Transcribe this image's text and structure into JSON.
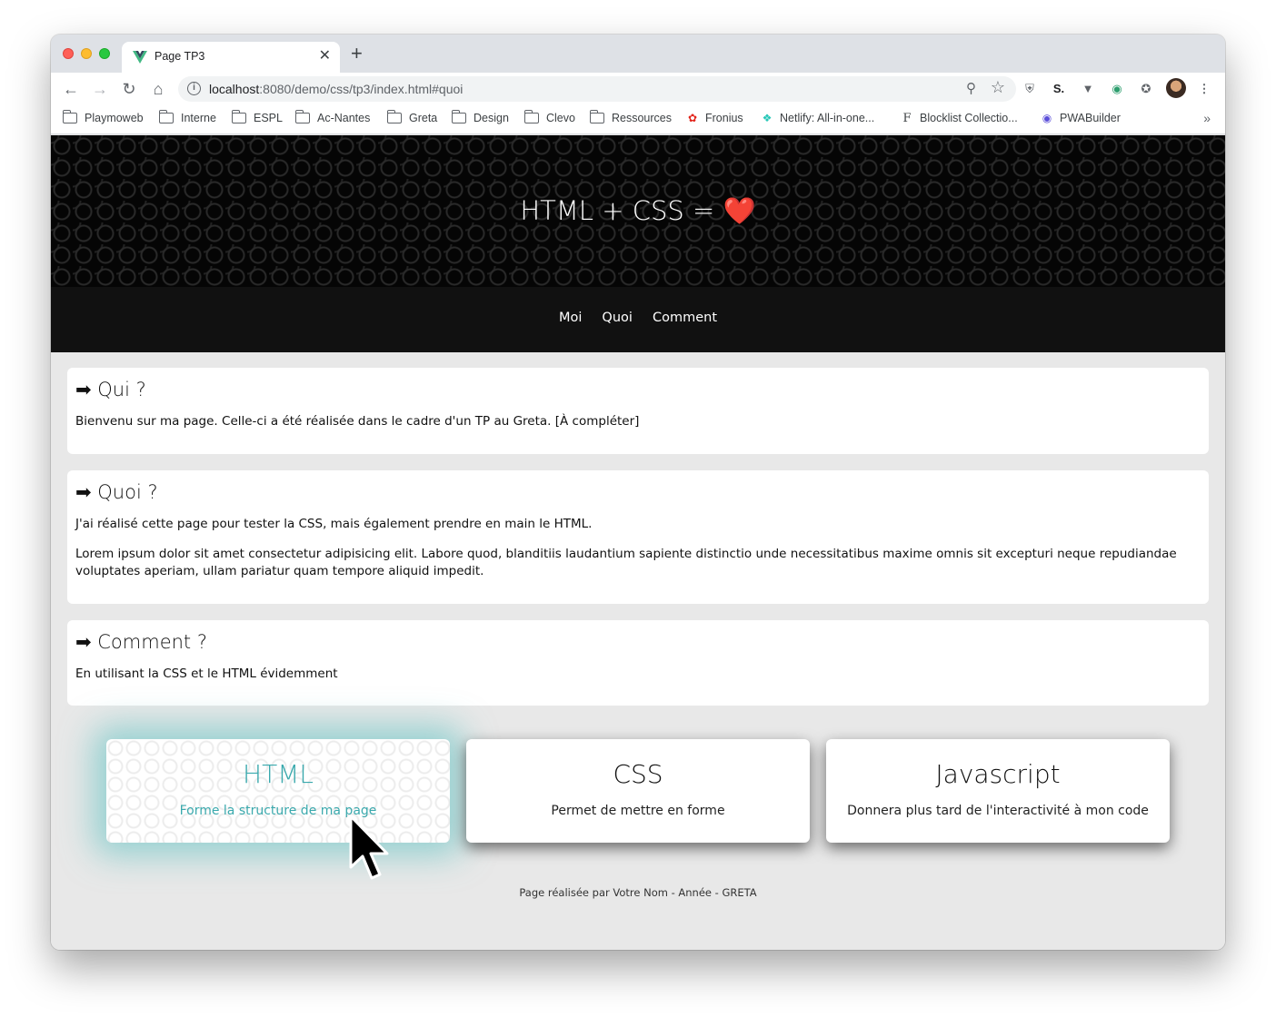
{
  "browser": {
    "tab_title": "Page TP3",
    "new_tab_icon": "+",
    "close_icon": "✕",
    "url_host": "localhost",
    "url_path": ":8080/demo/css/tp3/index.html#quoi",
    "bookmarks": [
      {
        "label": "Playmoweb",
        "icon": "folder-icon"
      },
      {
        "label": "Interne",
        "icon": "folder-icon"
      },
      {
        "label": "ESPL",
        "icon": "folder-icon"
      },
      {
        "label": "Ac-Nantes",
        "icon": "folder-icon"
      },
      {
        "label": "Greta",
        "icon": "folder-icon"
      },
      {
        "label": "Design",
        "icon": "folder-icon"
      },
      {
        "label": "Clevo",
        "icon": "folder-icon"
      },
      {
        "label": "Ressources",
        "icon": "folder-icon"
      },
      {
        "label": "Fronius",
        "icon": "fronius-icon"
      },
      {
        "label": "Netlify: All-in-one...",
        "icon": "netlify-icon"
      },
      {
        "label": "Blocklist Collectio...",
        "icon": "blocklist-icon"
      },
      {
        "label": "PWABuilder",
        "icon": "pwabuilder-icon"
      }
    ],
    "more_bookmarks": "»"
  },
  "page": {
    "hero_title": "HTML + CSS = ❤️",
    "nav": [
      "Moi",
      "Quoi",
      "Comment"
    ],
    "sections": [
      {
        "title": "➡ Qui ?",
        "paragraphs": [
          "Bienvenu sur ma page. Celle-ci a été réalisée dans le cadre d'un TP au Greta. [À compléter]"
        ]
      },
      {
        "title": "➡ Quoi ?",
        "paragraphs": [
          "J'ai réalisé cette page pour tester la CSS, mais également prendre en main le HTML.",
          "Lorem ipsum dolor sit amet consectetur adipisicing elit. Labore quod, blanditiis laudantium sapiente distinctio unde necessitatibus maxime omnis sit excepturi neque repudiandae voluptates aperiam, ullam pariatur quam tempore aliquid impedit."
        ]
      },
      {
        "title": "➡ Comment ?",
        "paragraphs": [
          "En utilisant la CSS et le HTML évidemment"
        ]
      }
    ],
    "features": [
      {
        "title": "HTML",
        "text": "Forme la structure de ma page"
      },
      {
        "title": "CSS",
        "text": "Permet de mettre en forme"
      },
      {
        "title": "Javascript",
        "text": "Donnera plus tard de l'interactivité à mon code"
      }
    ],
    "footer": "Page réalisée par Votre Nom - Année - GRETA"
  },
  "colors": {
    "accent": "#3aa9ad",
    "nav_bg": "#111111",
    "page_bg": "#e8e8e8"
  }
}
